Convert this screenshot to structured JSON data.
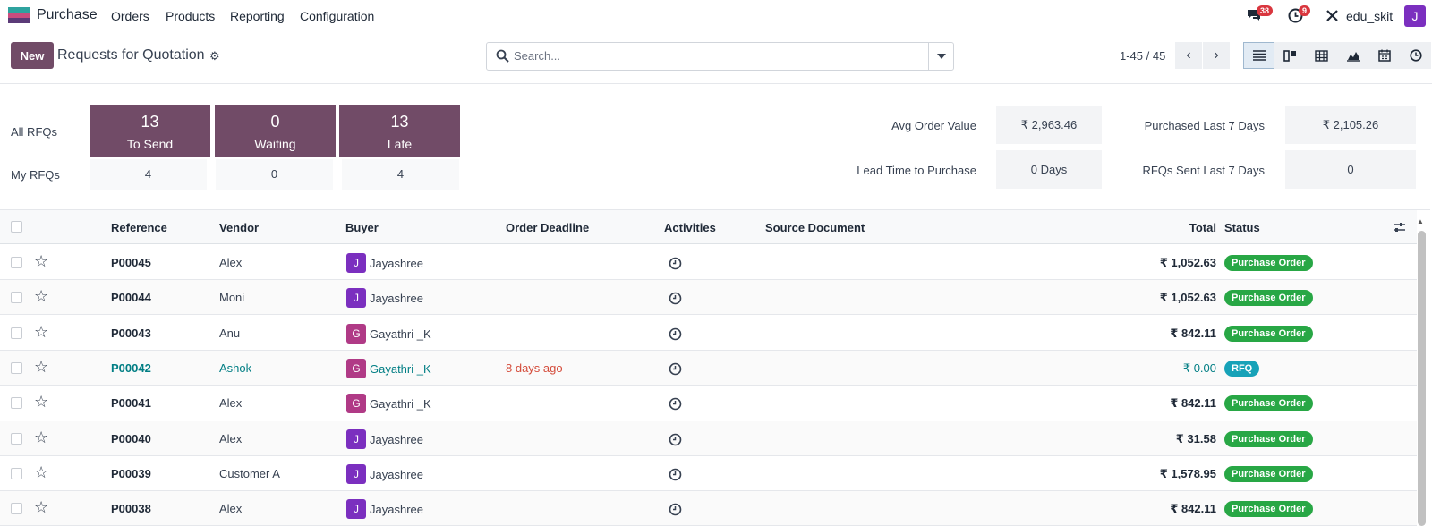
{
  "app": {
    "name": "Purchase"
  },
  "menu": [
    "Orders",
    "Products",
    "Reporting",
    "Configuration"
  ],
  "systray": {
    "messages_count": "38",
    "activities_count": "9",
    "user": "edu_skit",
    "user_initial": "J"
  },
  "control": {
    "new_label": "New",
    "title": "Requests for Quotation",
    "search_placeholder": "Search...",
    "pager": "1-45 / 45"
  },
  "dashboard": {
    "row_all": "All RFQs",
    "row_mine": "My RFQs",
    "tiles": [
      {
        "num": "13",
        "label": "To Send",
        "mine": "4"
      },
      {
        "num": "0",
        "label": "Waiting",
        "mine": "0"
      },
      {
        "num": "13",
        "label": "Late",
        "mine": "4"
      }
    ],
    "stats": [
      {
        "label": "Avg Order Value",
        "value": "₹ 2,963.46"
      },
      {
        "label": "Purchased Last 7 Days",
        "value": "₹ 2,105.26"
      },
      {
        "label": "Lead Time to Purchase",
        "value": "0 Days"
      },
      {
        "label": "RFQs Sent Last 7 Days",
        "value": "0"
      }
    ]
  },
  "table": {
    "headers": {
      "reference": "Reference",
      "vendor": "Vendor",
      "buyer": "Buyer",
      "deadline": "Order Deadline",
      "activities": "Activities",
      "source": "Source Document",
      "total": "Total",
      "status": "Status"
    },
    "rows": [
      {
        "ref": "P00045",
        "vendor": "Alex",
        "buyer": "Jayashree",
        "initial": "J",
        "deadline": "",
        "total": "₹ 1,052.63",
        "status": "Purchase Order"
      },
      {
        "ref": "P00044",
        "vendor": "Moni",
        "buyer": "Jayashree",
        "initial": "J",
        "deadline": "",
        "total": "₹ 1,052.63",
        "status": "Purchase Order"
      },
      {
        "ref": "P00043",
        "vendor": "Anu",
        "buyer": "Gayathri _K",
        "initial": "G",
        "deadline": "",
        "total": "₹ 842.11",
        "status": "Purchase Order"
      },
      {
        "ref": "P00042",
        "vendor": "Ashok",
        "buyer": "Gayathri _K",
        "initial": "G",
        "deadline": "8 days ago",
        "total": "₹ 0.00",
        "status": "RFQ"
      },
      {
        "ref": "P00041",
        "vendor": "Alex",
        "buyer": "Gayathri _K",
        "initial": "G",
        "deadline": "",
        "total": "₹ 842.11",
        "status": "Purchase Order"
      },
      {
        "ref": "P00040",
        "vendor": "Alex",
        "buyer": "Jayashree",
        "initial": "J",
        "deadline": "",
        "total": "₹ 31.58",
        "status": "Purchase Order"
      },
      {
        "ref": "P00039",
        "vendor": "Customer A",
        "buyer": "Jayashree",
        "initial": "J",
        "deadline": "",
        "total": "₹ 1,578.95",
        "status": "Purchase Order"
      },
      {
        "ref": "P00038",
        "vendor": "Alex",
        "buyer": "Jayashree",
        "initial": "J",
        "deadline": "",
        "total": "₹ 842.11",
        "status": "Purchase Order"
      }
    ]
  },
  "colors": {
    "brand": "#714b67",
    "rfq_pill": "#17a2b8",
    "po_pill": "#28a745",
    "draft_link": "#017e84",
    "overdue": "#d44c3b",
    "avatar_j": "#7b2fbf",
    "avatar_g": "#b03a86"
  }
}
